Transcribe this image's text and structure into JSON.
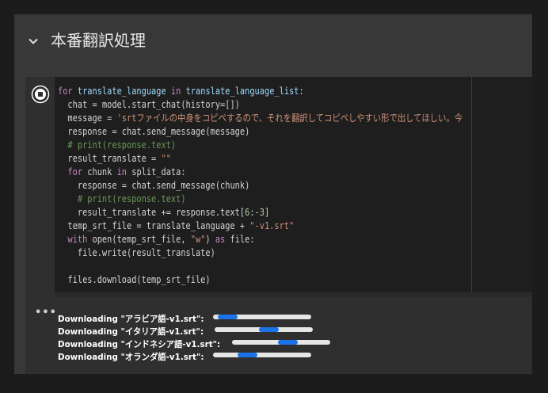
{
  "section": {
    "title": "本番翻訳処理"
  },
  "code_lines": [
    [
      {
        "t": "for ",
        "c": "kw"
      },
      {
        "t": "translate_language ",
        "c": "nm"
      },
      {
        "t": "in ",
        "c": "kw"
      },
      {
        "t": "translate_language_list:",
        "c": "nm"
      }
    ],
    [
      {
        "t": "  chat = model.start_chat(history=[])",
        "c": ""
      }
    ],
    [
      {
        "t": "  message = ",
        "c": ""
      },
      {
        "t": "'srtファイルの中身をコピペするので、それを翻訳してコピペしやすい形で出してほしい。今",
        "c": "str"
      }
    ],
    [
      {
        "t": "  response = chat.send_message(message)",
        "c": ""
      }
    ],
    [
      {
        "t": "  # print(response.text)",
        "c": "cm"
      }
    ],
    [
      {
        "t": "  result_translate = ",
        "c": ""
      },
      {
        "t": "\"\"",
        "c": "str"
      }
    ],
    [
      {
        "t": "  ",
        "c": ""
      },
      {
        "t": "for ",
        "c": "kw"
      },
      {
        "t": "chunk ",
        "c": ""
      },
      {
        "t": "in ",
        "c": "kw"
      },
      {
        "t": "split_data:",
        "c": ""
      }
    ],
    [
      {
        "t": "    response = chat.send_message(chunk)",
        "c": ""
      }
    ],
    [
      {
        "t": "    # print(response.text)",
        "c": "cm"
      }
    ],
    [
      {
        "t": "    result_translate += response.text[",
        "c": ""
      },
      {
        "t": "6",
        "c": "num"
      },
      {
        "t": ":",
        "c": ""
      },
      {
        "t": "-3",
        "c": "num"
      },
      {
        "t": "]",
        "c": ""
      }
    ],
    [
      {
        "t": "  temp_srt_file = translate_language + ",
        "c": ""
      },
      {
        "t": "\"-v1.srt\"",
        "c": "str"
      }
    ],
    [
      {
        "t": "  ",
        "c": ""
      },
      {
        "t": "with ",
        "c": "kw"
      },
      {
        "t": "open(temp_srt_file, ",
        "c": ""
      },
      {
        "t": "\"w\"",
        "c": "str"
      },
      {
        "t": ") ",
        "c": ""
      },
      {
        "t": "as ",
        "c": "kw"
      },
      {
        "t": "file:",
        "c": ""
      }
    ],
    [
      {
        "t": "    file.write(result_translate)",
        "c": ""
      }
    ],
    [
      {
        "t": "",
        "c": ""
      }
    ],
    [
      {
        "t": "  files.download(temp_srt_file)",
        "c": ""
      }
    ]
  ],
  "output": {
    "more_label": "•••",
    "downloads": [
      {
        "label": "Downloading \"アラビア語-v1.srt\":",
        "progress": 0.2,
        "fill_start": 0.05
      },
      {
        "label": "Downloading \"イタリア語-v1.srt\":",
        "progress": 0.2,
        "fill_start": 0.45
      },
      {
        "label": "Downloading \"インドネシア語-v1.srt\":",
        "progress": 0.2,
        "fill_start": 0.47
      },
      {
        "label": "Downloading \"オランダ語-v1.srt\":",
        "progress": 0.2,
        "fill_start": 0.25
      }
    ]
  },
  "colors": {
    "progress_fill": "#1a73e8",
    "progress_track": "#e6e6e6"
  },
  "icons": {
    "section_toggle": "chevron-down-icon",
    "run": "stop-run-icon",
    "more": "more-horiz-icon"
  }
}
